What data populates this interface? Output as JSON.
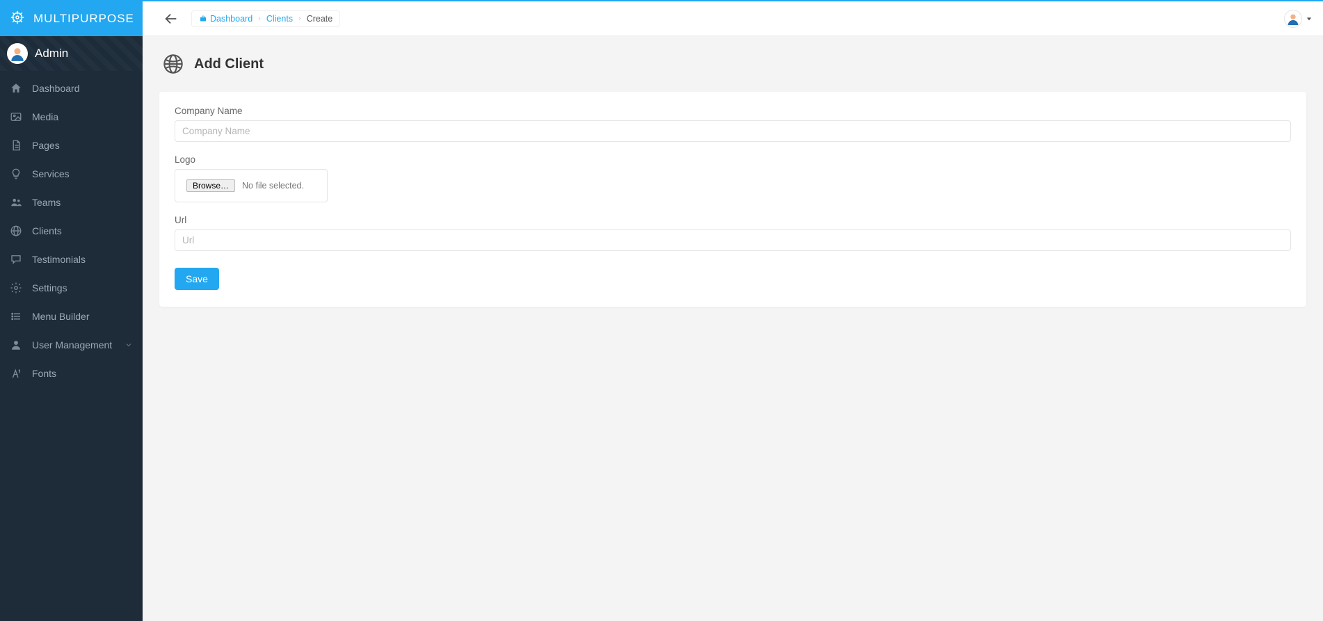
{
  "brand": {
    "name": "MULTIPURPOSE"
  },
  "user": {
    "name": "Admin"
  },
  "nav": {
    "items": [
      {
        "id": "dashboard",
        "label": "Dashboard",
        "icon": "home"
      },
      {
        "id": "media",
        "label": "Media",
        "icon": "image"
      },
      {
        "id": "pages",
        "label": "Pages",
        "icon": "file"
      },
      {
        "id": "services",
        "label": "Services",
        "icon": "bulb"
      },
      {
        "id": "teams",
        "label": "Teams",
        "icon": "users"
      },
      {
        "id": "clients",
        "label": "Clients",
        "icon": "globe"
      },
      {
        "id": "testimonials",
        "label": "Testimonials",
        "icon": "chat"
      },
      {
        "id": "settings",
        "label": "Settings",
        "icon": "gear"
      },
      {
        "id": "menu-builder",
        "label": "Menu Builder",
        "icon": "list"
      },
      {
        "id": "user-management",
        "label": "User Management",
        "icon": "user",
        "has_children": true
      },
      {
        "id": "fonts",
        "label": "Fonts",
        "icon": "font"
      }
    ]
  },
  "breadcrumb": {
    "dashboard": "Dashboard",
    "clients": "Clients",
    "current": "Create"
  },
  "page": {
    "title": "Add Client"
  },
  "form": {
    "company_name": {
      "label": "Company Name",
      "placeholder": "Company Name",
      "value": ""
    },
    "logo": {
      "label": "Logo",
      "browse_label": "Browse…",
      "status": "No file selected."
    },
    "url": {
      "label": "Url",
      "placeholder": "Url",
      "value": ""
    },
    "save_label": "Save"
  },
  "colors": {
    "accent": "#22a7f0",
    "sidebar_bg": "#1e2b38"
  }
}
